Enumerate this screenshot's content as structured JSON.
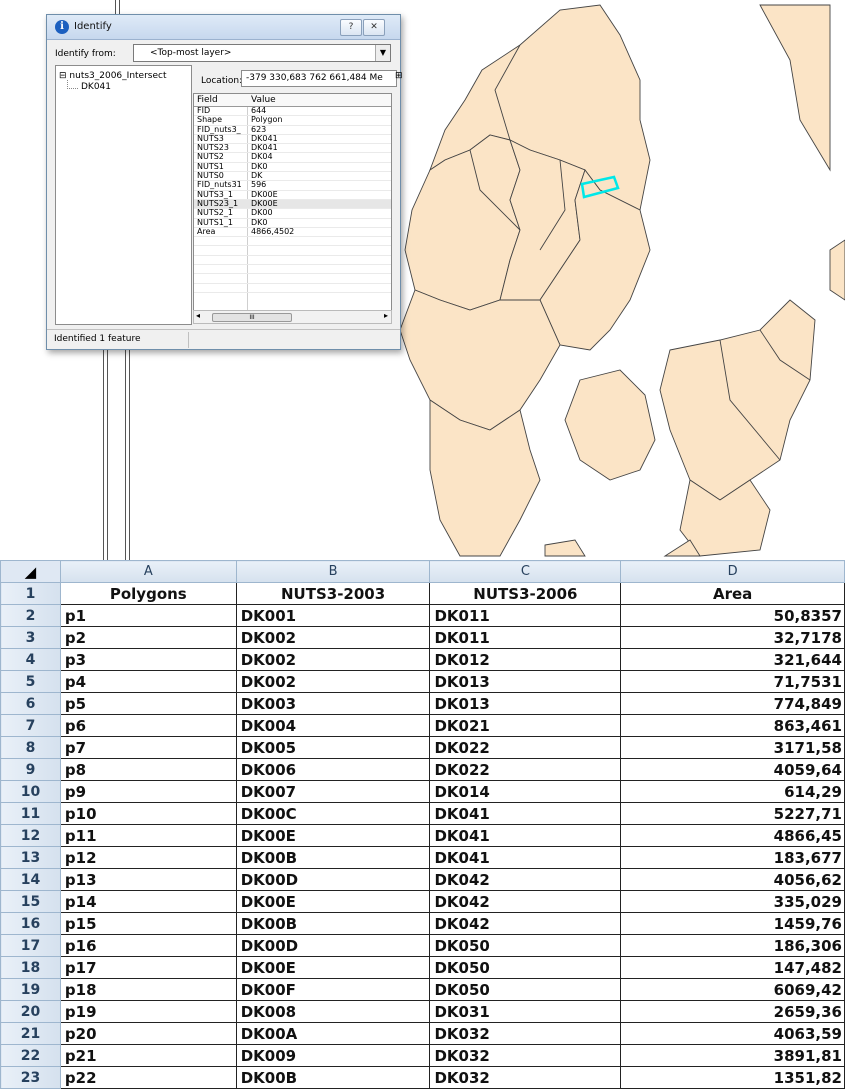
{
  "identify": {
    "title": "Identify",
    "help_button": "?",
    "close_button": "✕",
    "identify_from_label": "Identify from:",
    "identify_from_value": "<Top-most layer>",
    "tree_root": "nuts3_2006_Intersect",
    "tree_child": "DK041",
    "location_label": "Location:",
    "location_value": "-379 330,683  762 661,484 Me",
    "grid_header": {
      "field": "Field",
      "value": "Value"
    },
    "rows": [
      {
        "field": "FID",
        "value": "644"
      },
      {
        "field": "Shape",
        "value": "Polygon"
      },
      {
        "field": "FID_nuts3_",
        "value": "623"
      },
      {
        "field": "NUTS3",
        "value": "DK041"
      },
      {
        "field": "NUTS23",
        "value": "DK041"
      },
      {
        "field": "NUTS2",
        "value": "DK04"
      },
      {
        "field": "NUTS1",
        "value": "DK0"
      },
      {
        "field": "NUTS0",
        "value": "DK"
      },
      {
        "field": "FID_nuts31",
        "value": "596"
      },
      {
        "field": "NUTS3_1",
        "value": "DK00E"
      },
      {
        "field": "NUTS23_1",
        "value": "DK00E"
      },
      {
        "field": "NUTS2_1",
        "value": "DK00"
      },
      {
        "field": "NUTS1_1",
        "value": "DK0"
      },
      {
        "field": "Area",
        "value": "4866,4502"
      }
    ],
    "status": "Identified 1 feature",
    "map_fill": "#fbe4c6",
    "highlight_color": "#00e8e8"
  },
  "sheet": {
    "columns": [
      "A",
      "B",
      "C",
      "D"
    ],
    "header": [
      "Polygons",
      "NUTS3-2003",
      "NUTS3-2006",
      "Area"
    ],
    "rows": [
      [
        "p1",
        "DK001",
        "DK011",
        "50,8357"
      ],
      [
        "p2",
        "DK002",
        "DK011",
        "32,7178"
      ],
      [
        "p3",
        "DK002",
        "DK012",
        "321,644"
      ],
      [
        "p4",
        "DK002",
        "DK013",
        "71,7531"
      ],
      [
        "p5",
        "DK003",
        "DK013",
        "774,849"
      ],
      [
        "p6",
        "DK004",
        "DK021",
        "863,461"
      ],
      [
        "p7",
        "DK005",
        "DK022",
        "3171,58"
      ],
      [
        "p8",
        "DK006",
        "DK022",
        "4059,64"
      ],
      [
        "p9",
        "DK007",
        "DK014",
        "614,29"
      ],
      [
        "p10",
        "DK00C",
        "DK041",
        "5227,71"
      ],
      [
        "p11",
        "DK00E",
        "DK041",
        "4866,45"
      ],
      [
        "p12",
        "DK00B",
        "DK041",
        "183,677"
      ],
      [
        "p13",
        "DK00D",
        "DK042",
        "4056,62"
      ],
      [
        "p14",
        "DK00E",
        "DK042",
        "335,029"
      ],
      [
        "p15",
        "DK00B",
        "DK042",
        "1459,76"
      ],
      [
        "p16",
        "DK00D",
        "DK050",
        "186,306"
      ],
      [
        "p17",
        "DK00E",
        "DK050",
        "147,482"
      ],
      [
        "p18",
        "DK00F",
        "DK050",
        "6069,42"
      ],
      [
        "p19",
        "DK008",
        "DK031",
        "2659,36"
      ],
      [
        "p20",
        "DK00A",
        "DK032",
        "4063,59"
      ],
      [
        "p21",
        "DK009",
        "DK032",
        "3891,81"
      ],
      [
        "p22",
        "DK00B",
        "DK032",
        "1351,82"
      ]
    ]
  }
}
